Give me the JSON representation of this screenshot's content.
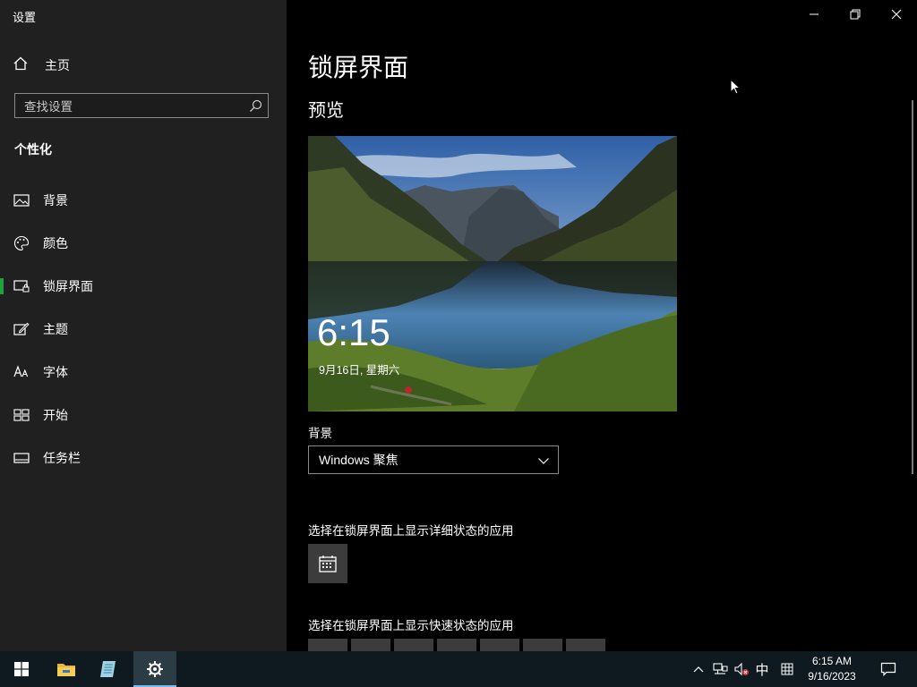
{
  "app": {
    "title": "设置"
  },
  "sidebar": {
    "home_label": "主页",
    "search_placeholder": "查找设置",
    "section_title": "个性化",
    "items": [
      {
        "label": "背景",
        "icon": "picture-icon"
      },
      {
        "label": "颜色",
        "icon": "palette-icon"
      },
      {
        "label": "锁屏界面",
        "icon": "lock-screen-icon",
        "selected": true
      },
      {
        "label": "主题",
        "icon": "theme-pen-icon"
      },
      {
        "label": "字体",
        "icon": "font-icon"
      },
      {
        "label": "开始",
        "icon": "start-grid-icon"
      },
      {
        "label": "任务栏",
        "icon": "taskbar-icon"
      }
    ],
    "accent_color": "#1fa33d"
  },
  "main": {
    "page_title": "锁屏界面",
    "preview_label": "预览",
    "preview_time": "6:15",
    "preview_date": "9月16日, 星期六",
    "background_label": "背景",
    "background_value": "Windows 聚焦",
    "detail_status_label": "选择在锁屏界面上显示详细状态的应用",
    "detail_status_app_icon": "calendar-icon",
    "quick_status_label": "选择在锁屏界面上显示快速状态的应用"
  },
  "taskbar": {
    "apps": [
      "windows-start-icon",
      "file-explorer-icon",
      "notepad-icon",
      "settings-gear-icon"
    ],
    "ime_mode": "中",
    "time": "6:15 AM",
    "date": "9/16/2023",
    "accent_color": "#76b9ed"
  }
}
